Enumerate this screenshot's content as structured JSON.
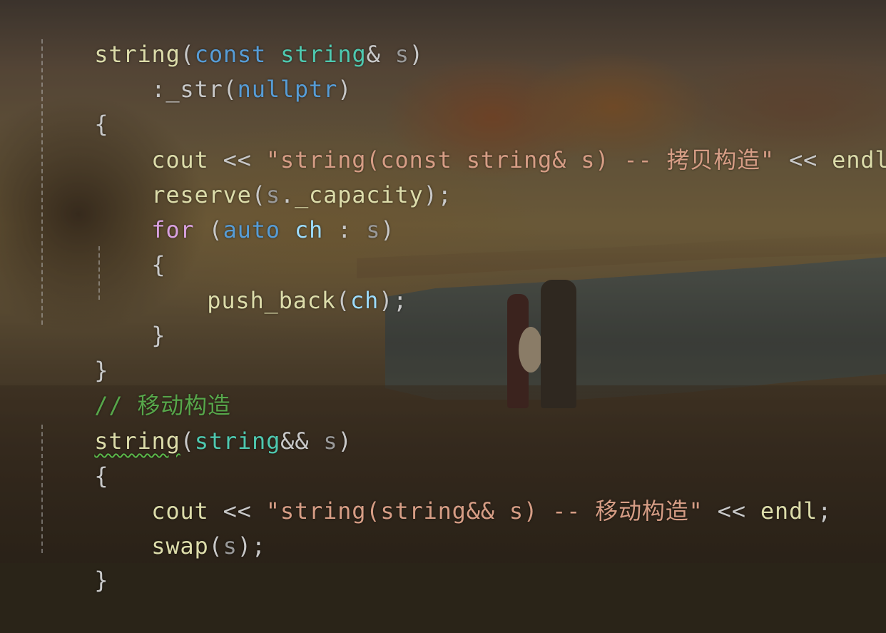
{
  "code_lines": [
    {
      "t1": "string",
      "t2": "(",
      "t3": "const",
      "t4": " ",
      "t5": "string",
      "t6": "&",
      "t7": " s",
      "t8": ")"
    },
    {
      "t1": ":_str",
      "t2": "(",
      "t3": "nullptr",
      "t4": ")"
    },
    {
      "t1": "{"
    },
    {
      "t1": "cout",
      "t2": " << ",
      "t3": "\"string(const string& s) -- 拷贝构造\"",
      "t4": " << ",
      "t5": "endl",
      "t6": ";"
    },
    {
      "t1": "reserve",
      "t2": "(",
      "t3": "s",
      "t4": ".",
      "t5": "_capacity",
      "t6": ");"
    },
    {
      "t1": "for",
      "t2": " (",
      "t3": "auto",
      "t4": " ",
      "t5": "ch",
      "t6": " : ",
      "t7": "s",
      "t8": ")"
    },
    {
      "t1": "{"
    },
    {
      "t1": "push_back",
      "t2": "(",
      "t3": "ch",
      "t4": ");"
    },
    {
      "t1": "}"
    },
    {
      "t1": "}"
    },
    {
      "t1": "// 移动构造"
    },
    {
      "t1": "string",
      "t2": "(",
      "t3": "string",
      "t4": "&&",
      "t5": " s",
      "t6": ")"
    },
    {
      "t1": "{"
    },
    {
      "t1": "cout",
      "t2": " << ",
      "t3": "\"string(string&& s) -- 移动构造\"",
      "t4": " << ",
      "t5": "endl",
      "t6": ";"
    },
    {
      "t1": "swap",
      "t2": "(",
      "t3": "s",
      "t4": ");"
    },
    {
      "t1": "}"
    }
  ],
  "colors": {
    "function": "#dcdcaa",
    "type": "#4ec9b0",
    "keyword": "#569cd6",
    "control": "#d8a0df",
    "variable": "#9cdcfe",
    "string": "#d69d85",
    "comment": "#57a64a",
    "punctuation": "#c8c8c8",
    "parameter": "#9a9a9a",
    "squiggle": "#5ab84a"
  }
}
